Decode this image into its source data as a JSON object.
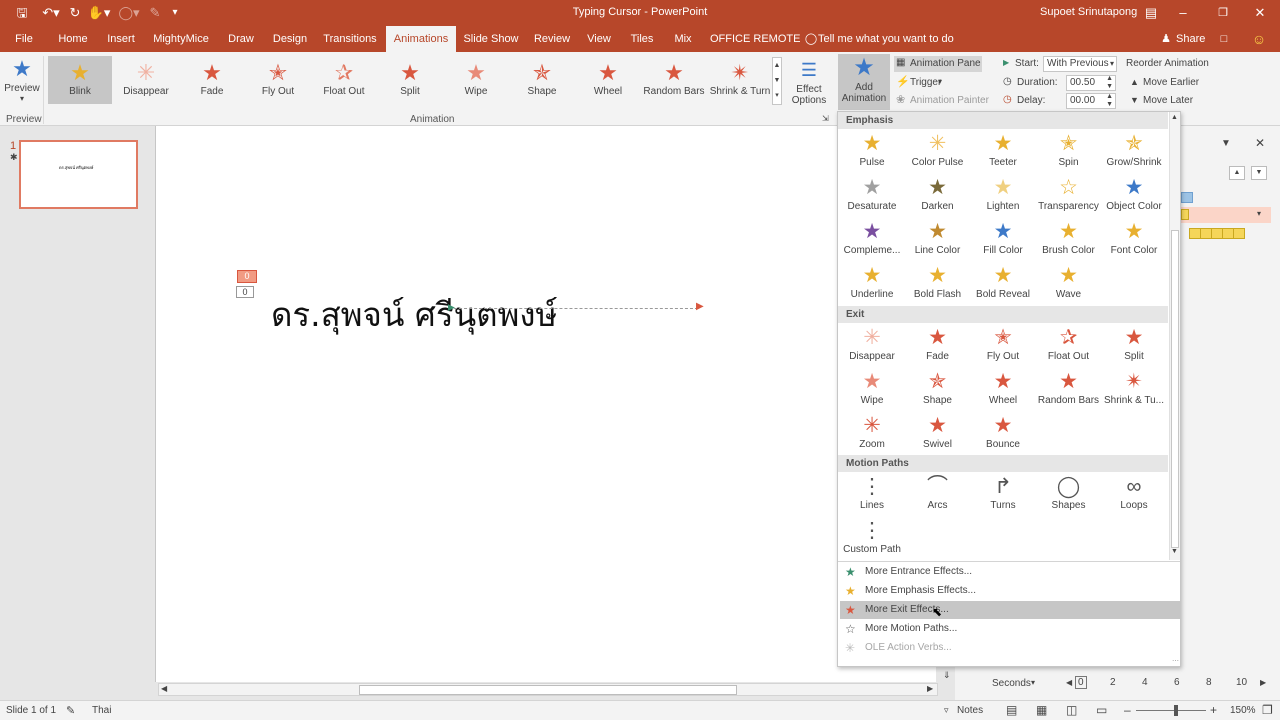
{
  "window": {
    "title": "Typing Cursor - PowerPoint",
    "user": "Supoet Srinutapong"
  },
  "tabs": [
    "File",
    "Home",
    "Insert",
    "MightyMice",
    "Draw",
    "Design",
    "Transitions",
    "Animations",
    "Slide Show",
    "Review",
    "View",
    "Tiles",
    "Mix",
    "OFFICE REMOTE"
  ],
  "tell_me": "Tell me what you want to do",
  "share": "Share",
  "ribbon": {
    "preview": "Preview",
    "preview_group": "Preview",
    "animation_group": "Animation",
    "gallery": [
      "Blink",
      "Disappear",
      "Fade",
      "Fly Out",
      "Float Out",
      "Split",
      "Wipe",
      "Shape",
      "Wheel",
      "Random Bars",
      "Shrink & Turn"
    ],
    "effect_options": [
      "Effect",
      "Options"
    ],
    "add_animation": [
      "Add",
      "Animation"
    ],
    "animation_pane": "Animation Pane",
    "trigger": "Trigger",
    "animation_painter": "Animation Painter",
    "start_label": "Start:",
    "start_value": "With Previous",
    "duration_label": "Duration:",
    "duration_value": "00.50",
    "delay_label": "Delay:",
    "delay_value": "00.00",
    "reorder": "Reorder Animation",
    "move_earlier": "Move Earlier",
    "move_later": "Move Later"
  },
  "slides": {
    "number": "1",
    "thumb_text": "ดร.สุพจน์ ศรีนุตพงษ์"
  },
  "slide": {
    "text": "ดร.สุพจน์ ศรีนุตพงษ์",
    "tags": [
      "0",
      "0"
    ]
  },
  "menu": {
    "sections": [
      "Emphasis",
      "Exit",
      "Motion Paths"
    ],
    "emphasis": [
      "Pulse",
      "Color Pulse",
      "Teeter",
      "Spin",
      "Grow/Shrink",
      "Desaturate",
      "Darken",
      "Lighten",
      "Transparency",
      "Object Color",
      "Compleme...",
      "Line Color",
      "Fill Color",
      "Brush Color",
      "Font Color",
      "Underline",
      "Bold Flash",
      "Bold Reveal",
      "Wave"
    ],
    "exit": [
      "Disappear",
      "Fade",
      "Fly Out",
      "Float Out",
      "Split",
      "Wipe",
      "Shape",
      "Wheel",
      "Random Bars",
      "Shrink & Tu...",
      "Zoom",
      "Swivel",
      "Bounce"
    ],
    "motion": [
      "Lines",
      "Arcs",
      "Turns",
      "Shapes",
      "Loops",
      "Custom Path"
    ],
    "more": [
      "More Entrance Effects...",
      "More Emphasis Effects...",
      "More Exit Effects...",
      "More Motion Paths...",
      "OLE Action Verbs..."
    ]
  },
  "timeline": {
    "unit": "Seconds",
    "ticks": [
      "0",
      "2",
      "4",
      "6",
      "8",
      "10"
    ]
  },
  "status": {
    "slide": "Slide 1 of 1",
    "lang": "Thai",
    "notes": "Notes",
    "zoom": "150%"
  },
  "colors": {
    "accent": "#b7472a",
    "emphasis_star": "#e8b030",
    "exit_star": "#d9573f",
    "entrance_star": "#3a8f6e"
  }
}
